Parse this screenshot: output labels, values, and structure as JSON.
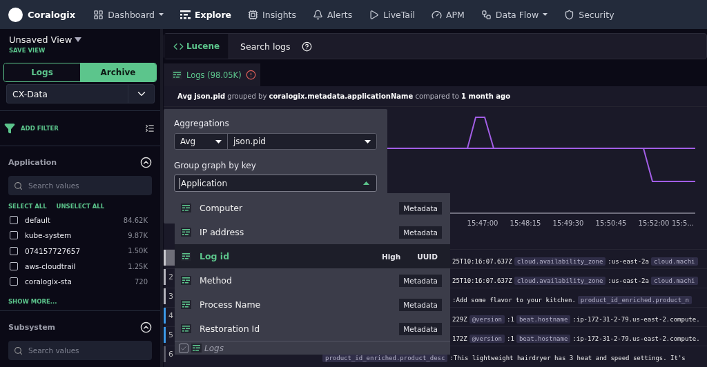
{
  "nav": {
    "brand": "Coralogix",
    "items": [
      {
        "label": "Dashboard",
        "selected": false,
        "menu": true
      },
      {
        "label": "Explore",
        "selected": true,
        "menu": false
      },
      {
        "label": "Insights",
        "selected": false,
        "menu": false
      },
      {
        "label": "Alerts",
        "selected": false,
        "menu": false
      },
      {
        "label": "LiveTail",
        "selected": false,
        "menu": false
      },
      {
        "label": "APM",
        "selected": false,
        "menu": false
      },
      {
        "label": "Data Flow",
        "selected": false,
        "menu": true
      },
      {
        "label": "Security",
        "selected": false,
        "menu": false
      }
    ]
  },
  "view": {
    "title": "Unsaved View",
    "save": "SAVE VIEW"
  },
  "source_toggle": [
    {
      "label": "Logs",
      "selected": false
    },
    {
      "label": "Archive",
      "selected": true
    }
  ],
  "dataset": {
    "value": "CX-Data"
  },
  "add_filter": "ADD FILTER",
  "filters": [
    {
      "title": "Application",
      "expanded": true,
      "placeholder": "Search values",
      "select_all": "SELECT ALL",
      "unselect_all": "UNSELECT ALL",
      "show_more": "SHOW MORE...",
      "values": [
        {
          "label": "default",
          "count": "84.62K",
          "checked": false
        },
        {
          "label": "kube-system",
          "count": "9.87K",
          "checked": false
        },
        {
          "label": "074157727657",
          "count": "1.50K",
          "checked": false
        },
        {
          "label": "aws-cloudtrail",
          "count": "1.25K",
          "checked": false
        },
        {
          "label": "coralogix-sta",
          "count": "720",
          "checked": false
        }
      ]
    },
    {
      "title": "Subsystem",
      "expanded": true,
      "placeholder": "Search values"
    }
  ],
  "query": {
    "mode": "Lucene",
    "placeholder": "Search logs"
  },
  "results_tab": {
    "label": "Logs (98.05K)",
    "selected": true
  },
  "summary": "**Avg** **json.pid** grouped by **coralogix.metadata.applicationName** compared to **1 month ago**",
  "chart": {
    "time_labels": [
      "15:47:00",
      "15:48:15",
      "15:49:30",
      "15:50:45",
      "15:52:00",
      "15:5..."
    ]
  },
  "log_rows": [
    {
      "selected": true,
      "color": "#c9c9cf",
      "segments": [
        {
          "kind": "text",
          "text": "25T10:16:07.637Z"
        },
        {
          "kind": "chip",
          "text": "cloud.availability_zone"
        },
        {
          "kind": "text",
          "text": ":us-east-2a"
        },
        {
          "kind": "chip",
          "text": "cloud.machi"
        }
      ]
    },
    {
      "number": "2",
      "selected": false,
      "color": "#b5b5bd",
      "segments": [
        {
          "kind": "text",
          "text": "25T10:16:07.637Z"
        },
        {
          "kind": "chip",
          "text": "cloud.availability_zone"
        },
        {
          "kind": "text",
          "text": ":us-east-2a"
        },
        {
          "kind": "chip",
          "text": "cloud.machi"
        }
      ]
    },
    {
      "number": "3",
      "selected": false,
      "color": "#b5b5bd",
      "segments": [
        {
          "kind": "text",
          "text": ":Add some flavor to your kitchen."
        },
        {
          "kind": "chip",
          "text": "product_id_enriched.product_n"
        }
      ]
    },
    {
      "number": "4",
      "selected": false,
      "color": "#3d9be9",
      "segments": [
        {
          "kind": "text",
          "text": "229Z"
        },
        {
          "kind": "chip",
          "text": "@version"
        },
        {
          "kind": "text",
          "text": ":1"
        },
        {
          "kind": "chip",
          "text": "beat.hostname"
        },
        {
          "kind": "text",
          "text": ":ip-172-31-2-79.us-east-2.compute."
        }
      ]
    },
    {
      "number": "5",
      "selected": false,
      "color": "#3d9be9",
      "segments": [
        {
          "kind": "text",
          "text": "172Z"
        },
        {
          "kind": "chip",
          "text": "@version"
        },
        {
          "kind": "text",
          "text": ":1"
        },
        {
          "kind": "chip",
          "text": "beat.hostname"
        },
        {
          "kind": "text",
          "text": ":ip-172-31-2-79.us-east-2.compute."
        }
      ]
    },
    {
      "number": "6",
      "selected": false,
      "color": "#5a5a66",
      "segments": [
        {
          "kind": "chip",
          "text": "product_id_enriched.product_desc"
        },
        {
          "kind": "text",
          "text": ":This lightweight hairdryer has 3 heat and speed settings. It's"
        }
      ]
    }
  ],
  "aggregation_popup": {
    "aggregations_label": "Aggregations",
    "function": "Avg",
    "field": "json.pid",
    "group_label": "Group graph by key",
    "group_value": "Application",
    "options": [
      {
        "label": "Computer",
        "tags": [
          "Metadata"
        ],
        "selected": false
      },
      {
        "label": "IP address",
        "tags": [
          "Metadata"
        ],
        "selected": false
      },
      {
        "label": "Log id",
        "tags": [
          "High",
          "UUID"
        ],
        "selected": true
      },
      {
        "label": "Method",
        "tags": [
          "Metadata"
        ],
        "selected": false
      },
      {
        "label": "Process Name",
        "tags": [
          "Metadata"
        ],
        "selected": false
      },
      {
        "label": "Restoration Id",
        "tags": [
          "Metadata"
        ],
        "selected": false
      }
    ],
    "footer": {
      "label": "Logs",
      "checked": true
    }
  }
}
